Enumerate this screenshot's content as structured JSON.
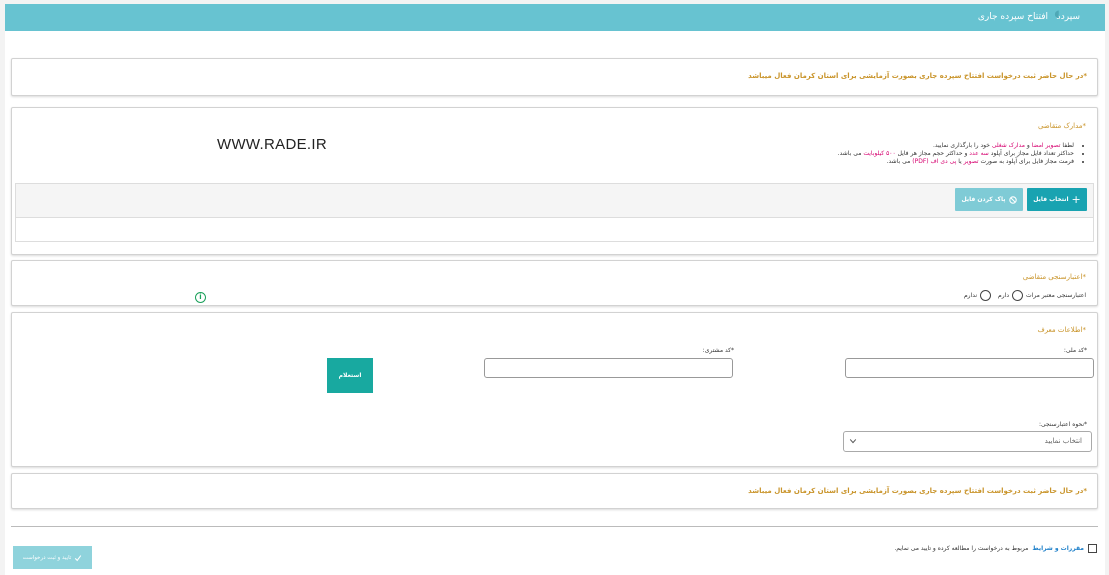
{
  "breadcrumb": {
    "home": "سپرده",
    "current": "افتتاح سپرده جاری"
  },
  "notice_top": "*در حال حاضر ثبت درخواست افتتاح سپرده جاری بصورت آزمایشی برای استان کرمان فعال میباشد",
  "documents": {
    "title": "*مدارک متقاضی",
    "bullets": [
      [
        "لطفا ",
        "تصویر امضا",
        " و ",
        "مدارک شغلی",
        " خود را بارگذاری نمایید."
      ],
      [
        "حداکثر تعداد فایل مجاز برای آپلود ",
        "سه عدد",
        " و حداکثر حجم مجاز هر فایل ",
        "۵۰۰ کیلوبایت",
        " می باشد."
      ],
      [
        "فرمت مجاز فایل برای آپلود به صورت ",
        "تصویر",
        " یا ",
        "پی دی اف (PDF)",
        " می باشد."
      ]
    ],
    "watermark": "WWW.RADE.IR",
    "choose_file_label": "انتخاب فایل",
    "clear_file_label": "پاک کردن فایل"
  },
  "credit": {
    "title": "*اعتبارسنجی متقاضی",
    "question": "اعتبارسنجی معتبر مرات",
    "option_yes": "دارم",
    "option_no": "ندارم"
  },
  "referrer": {
    "title": "*اطلاعات معرف",
    "national_code_label": "*کد ملی:",
    "customer_code_label": "*کد مشتری:",
    "inquiry_button": "استعلام",
    "method_label": "*نحوه اعتبارسنجی:",
    "method_placeholder": "انتخاب نمایید"
  },
  "notice_bottom": "*در حال حاضر ثبت درخواست افتتاح سپرده جاری بصورت آزمایشی برای استان کرمان فعال میباشد",
  "terms": {
    "link": "مقررات و شرایط",
    "text": "مربوط به درخواست را مطالعه کرده و تایید می نمایم."
  },
  "submit_label": "تایید و ثبت درخواست",
  "colors": {
    "header": "#67c3d1",
    "accent": "#19a3b1",
    "notice": "#c9942a",
    "highlight": "#d6006f"
  }
}
